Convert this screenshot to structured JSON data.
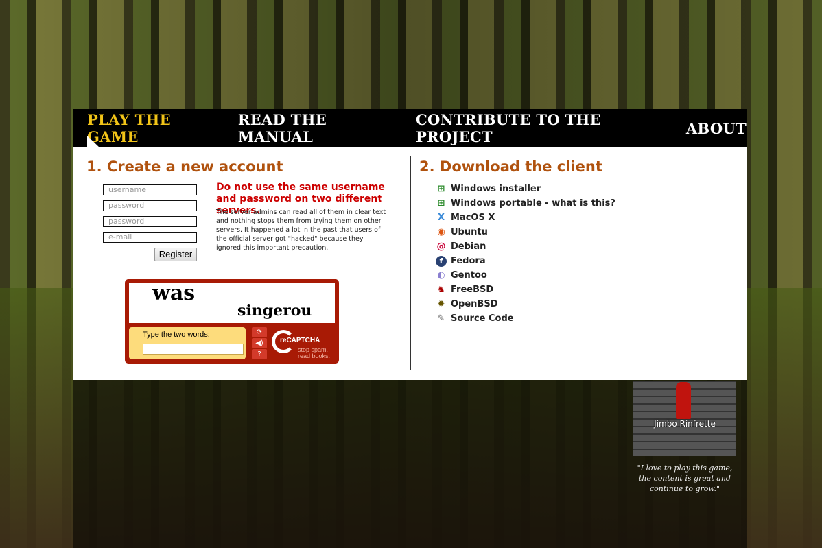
{
  "nav": {
    "items": [
      {
        "label": "PLAY THE GAME",
        "active": true
      },
      {
        "label": "READ THE MANUAL"
      },
      {
        "label": "CONTRIBUTE TO THE PROJECT"
      },
      {
        "label": "ABOUT"
      }
    ]
  },
  "account": {
    "title": "1. Create a new account",
    "username_placeholder": "username",
    "password_placeholder": "password",
    "password2_placeholder": "password",
    "email_placeholder": "e-mail",
    "register_label": "Register",
    "warning": "Do not use the same username and password on two different servers.",
    "info": "The server admins can read all of them in clear text and nothing stops them from trying them on other servers. It happened a lot in the past that users of the official server got \"hacked\" because they ignored this important precaution."
  },
  "captcha": {
    "word1": "was",
    "word2": "singerou",
    "prompt": "Type the two words:",
    "brand": "reCAPTCHA",
    "tagline1": "stop spam.",
    "tagline2": "read books."
  },
  "download": {
    "title": "2. Download the client",
    "items": [
      {
        "label": "Windows installer",
        "icon": "windows-icon"
      },
      {
        "label": "Windows portable - what is this?",
        "icon": "windows-icon"
      },
      {
        "label": "MacOS X",
        "icon": "macos-icon"
      },
      {
        "label": "Ubuntu",
        "icon": "ubuntu-icon"
      },
      {
        "label": "Debian",
        "icon": "debian-icon"
      },
      {
        "label": "Fedora",
        "icon": "fedora-icon"
      },
      {
        "label": "Gentoo",
        "icon": "gentoo-icon"
      },
      {
        "label": "FreeBSD",
        "icon": "freebsd-icon"
      },
      {
        "label": "OpenBSD",
        "icon": "openbsd-icon"
      },
      {
        "label": "Source Code",
        "icon": "source-code-icon"
      }
    ]
  },
  "testimonial": {
    "name": "Jimbo Rinfrette",
    "quote": "\"I love to play this game, the content is great and continue to grow.\""
  },
  "colors": {
    "accent": "#f2c418",
    "heading": "#b0520e",
    "warning": "#cc0000",
    "captcha": "#a81a05"
  }
}
